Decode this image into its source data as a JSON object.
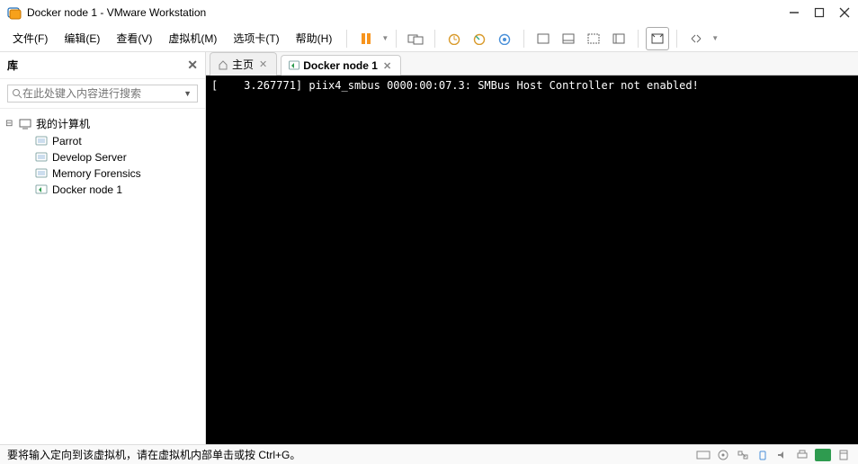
{
  "window": {
    "title": "Docker node 1 - VMware Workstation"
  },
  "menu": {
    "file": "文件(F)",
    "edit": "编辑(E)",
    "view": "查看(V)",
    "vm": "虚拟机(M)",
    "tabs": "选项卡(T)",
    "help": "帮助(H)"
  },
  "sidebar": {
    "title": "库",
    "search_placeholder": "在此处键入内容进行搜索",
    "root": "我的计算机",
    "items": [
      {
        "label": "Parrot"
      },
      {
        "label": "Develop Server"
      },
      {
        "label": "Memory Forensics"
      },
      {
        "label": "Docker node 1"
      }
    ]
  },
  "tabs": {
    "home": "主页",
    "active": "Docker node 1"
  },
  "console": {
    "line1": "[    3.267771] piix4_smbus 0000:00:07.3: SMBus Host Controller not enabled!"
  },
  "status": {
    "msg": "要将输入定向到该虚拟机，请在虚拟机内部单击或按 Ctrl+G。"
  }
}
